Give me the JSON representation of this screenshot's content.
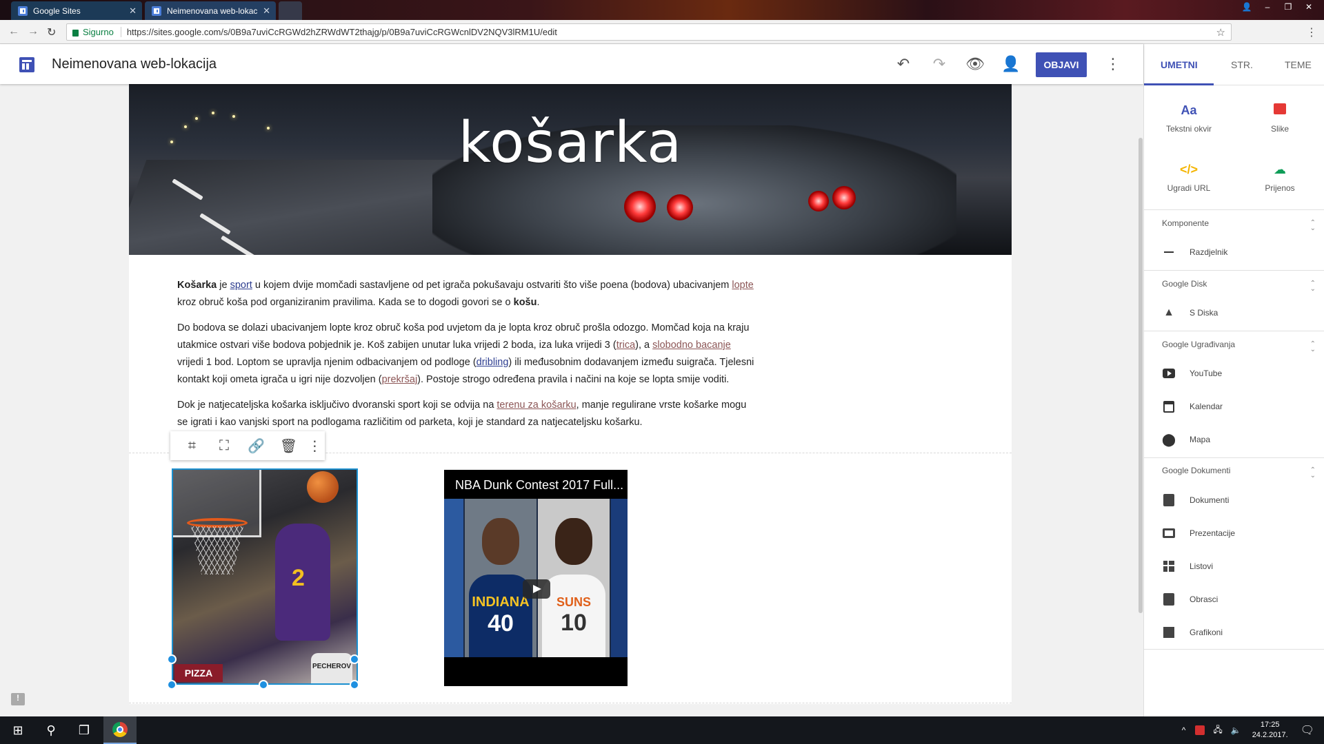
{
  "browser": {
    "tabs": [
      {
        "title": "Google Sites",
        "active": false
      },
      {
        "title": "Neimenovana web-lokac",
        "active": true
      }
    ],
    "secure_label": "Sigurno",
    "url": "https://sites.google.com/s/0B9a7uviCcRGWd2hZRWdWT2thajg/p/0B9a7uviCcRGWcnlDV2NQV3lRM1U/edit"
  },
  "header": {
    "site_name": "Neimenovana web-lokacija",
    "publish_label": "OBJAVI"
  },
  "banner": {
    "title": "košarka"
  },
  "article": {
    "p1": {
      "b1": "Košarka",
      "t1": " je ",
      "l1": "sport",
      "t2": " u kojem dvije momčadi sastavljene od pet igrača pokušavaju ostvariti što više poena (bodova) ubacivanjem ",
      "l2": "lopte",
      "t3": " kroz obruč koša pod organiziranim pravilima. Kada se to dogodi govori se o ",
      "b2": "košu",
      "t4": "."
    },
    "p2": {
      "t1": "Do bodova se dolazi ubacivanjem lopte kroz obruč koša pod uvjetom da je lopta kroz obruč prošla odozgo. Momčad koja na kraju utakmice ostvari više bodova pobjednik je. Koš zabijen unutar luka vrijedi 2 boda, iza luka vrijedi 3 (",
      "l1": "trica",
      "t2": "), a ",
      "l2": "slobodno bacanje",
      "t3": " vrijedi 1 bod. Loptom se upravlja njenim odbacivanjem od podloge (",
      "l3": "dribling",
      "t4": ") ili međusobnim dodavanjem između suigrača. Tjelesni kontakt koji ometa igrača u igri nije dozvoljen (",
      "l4": "prekršaj",
      "t5": "). Postoje strogo određena pravila i načini na koje se lopta smije voditi."
    },
    "p3": {
      "t1": "Dok je natjecateljska košarka isključivo dvoranski sport koji se odvija na ",
      "l1": "terenu za košarku",
      "t2": ", manje regulirane vrste košarke mogu se igrati i kao vanjski sport na podlogama različitim od parketa, koji je standard za natjecateljsku košarku."
    }
  },
  "image": {
    "sign_text": "PIZZA",
    "jersey_text": "PECHEROV"
  },
  "video": {
    "title": "NBA Dunk Contest 2017 Full...",
    "jersey1_team": "INDIANA",
    "jersey1_number": "40",
    "jersey2_team": "SUNS",
    "jersey2_number": "10"
  },
  "panel": {
    "tabs": [
      "UMETNI",
      "STR.",
      "TEME"
    ],
    "tiles": [
      {
        "label": "Tekstni okvir",
        "icon": "Aa"
      },
      {
        "label": "Slike",
        "icon": "image-icon"
      },
      {
        "label": "Ugradi URL",
        "icon": "</>"
      },
      {
        "label": "Prijenos",
        "icon": "upload-icon"
      }
    ],
    "sections": [
      {
        "title": "Komponente",
        "items": [
          "Razdjelnik"
        ]
      },
      {
        "title": "Google Disk",
        "items": [
          "S Diska"
        ]
      },
      {
        "title": "Google Ugrađivanja",
        "items": [
          "YouTube",
          "Kalendar",
          "Mapa"
        ]
      },
      {
        "title": "Google Dokumenti",
        "items": [
          "Dokumenti",
          "Prezentacije",
          "Listovi",
          "Obrasci",
          "Grafikoni"
        ]
      }
    ]
  },
  "taskbar": {
    "time": "17:25",
    "date": "24.2.2017."
  },
  "colors": {
    "accent": "#3f51b5",
    "link": "#8c5656",
    "selection": "#1a8fcf"
  }
}
